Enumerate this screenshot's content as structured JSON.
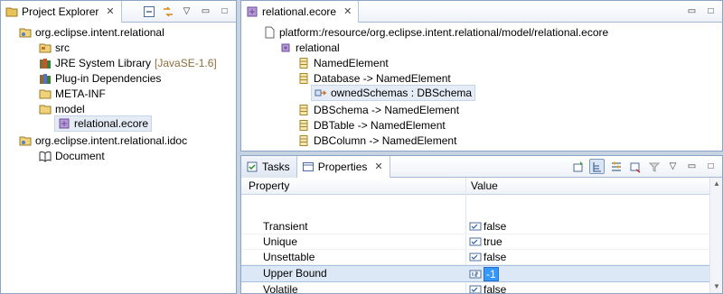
{
  "explorer": {
    "tab_label": "Project Explorer",
    "tree": [
      {
        "label": "org.eclipse.intent.relational"
      },
      {
        "label": "src"
      },
      {
        "label": "JRE System Library",
        "decoration": "[JavaSE-1.6]"
      },
      {
        "label": "Plug-in Dependencies"
      },
      {
        "label": "META-INF"
      },
      {
        "label": "model"
      },
      {
        "label": "relational.ecore"
      },
      {
        "label": "org.eclipse.intent.relational.idoc"
      },
      {
        "label": "Document"
      }
    ]
  },
  "editor": {
    "tab_label": "relational.ecore",
    "tree": [
      {
        "label": "platform:/resource/org.eclipse.intent.relational/model/relational.ecore"
      },
      {
        "label": "relational"
      },
      {
        "label": "NamedElement"
      },
      {
        "label": "Database -> NamedElement"
      },
      {
        "label": "ownedSchemas : DBSchema"
      },
      {
        "label": "DBSchema -> NamedElement"
      },
      {
        "label": "DBTable -> NamedElement"
      },
      {
        "label": "DBColumn -> NamedElement"
      }
    ]
  },
  "bottom": {
    "tabs": [
      {
        "label": "Tasks"
      },
      {
        "label": "Properties"
      }
    ],
    "columns": {
      "property": "Property",
      "value": "Value"
    },
    "rows": [
      {
        "property": "Transient",
        "value": "false"
      },
      {
        "property": "Unique",
        "value": "true"
      },
      {
        "property": "Unsettable",
        "value": "false"
      },
      {
        "property": "Upper Bound",
        "value": "-1"
      },
      {
        "property": "Volatile",
        "value": "false"
      }
    ]
  },
  "icons": {
    "close": "✕",
    "view_menu": "▽",
    "minimize": "▭",
    "maximize": "□"
  },
  "colors": {
    "selection": "#3399ff",
    "frame": "#8da5c5",
    "background": "#c6d3e2"
  }
}
